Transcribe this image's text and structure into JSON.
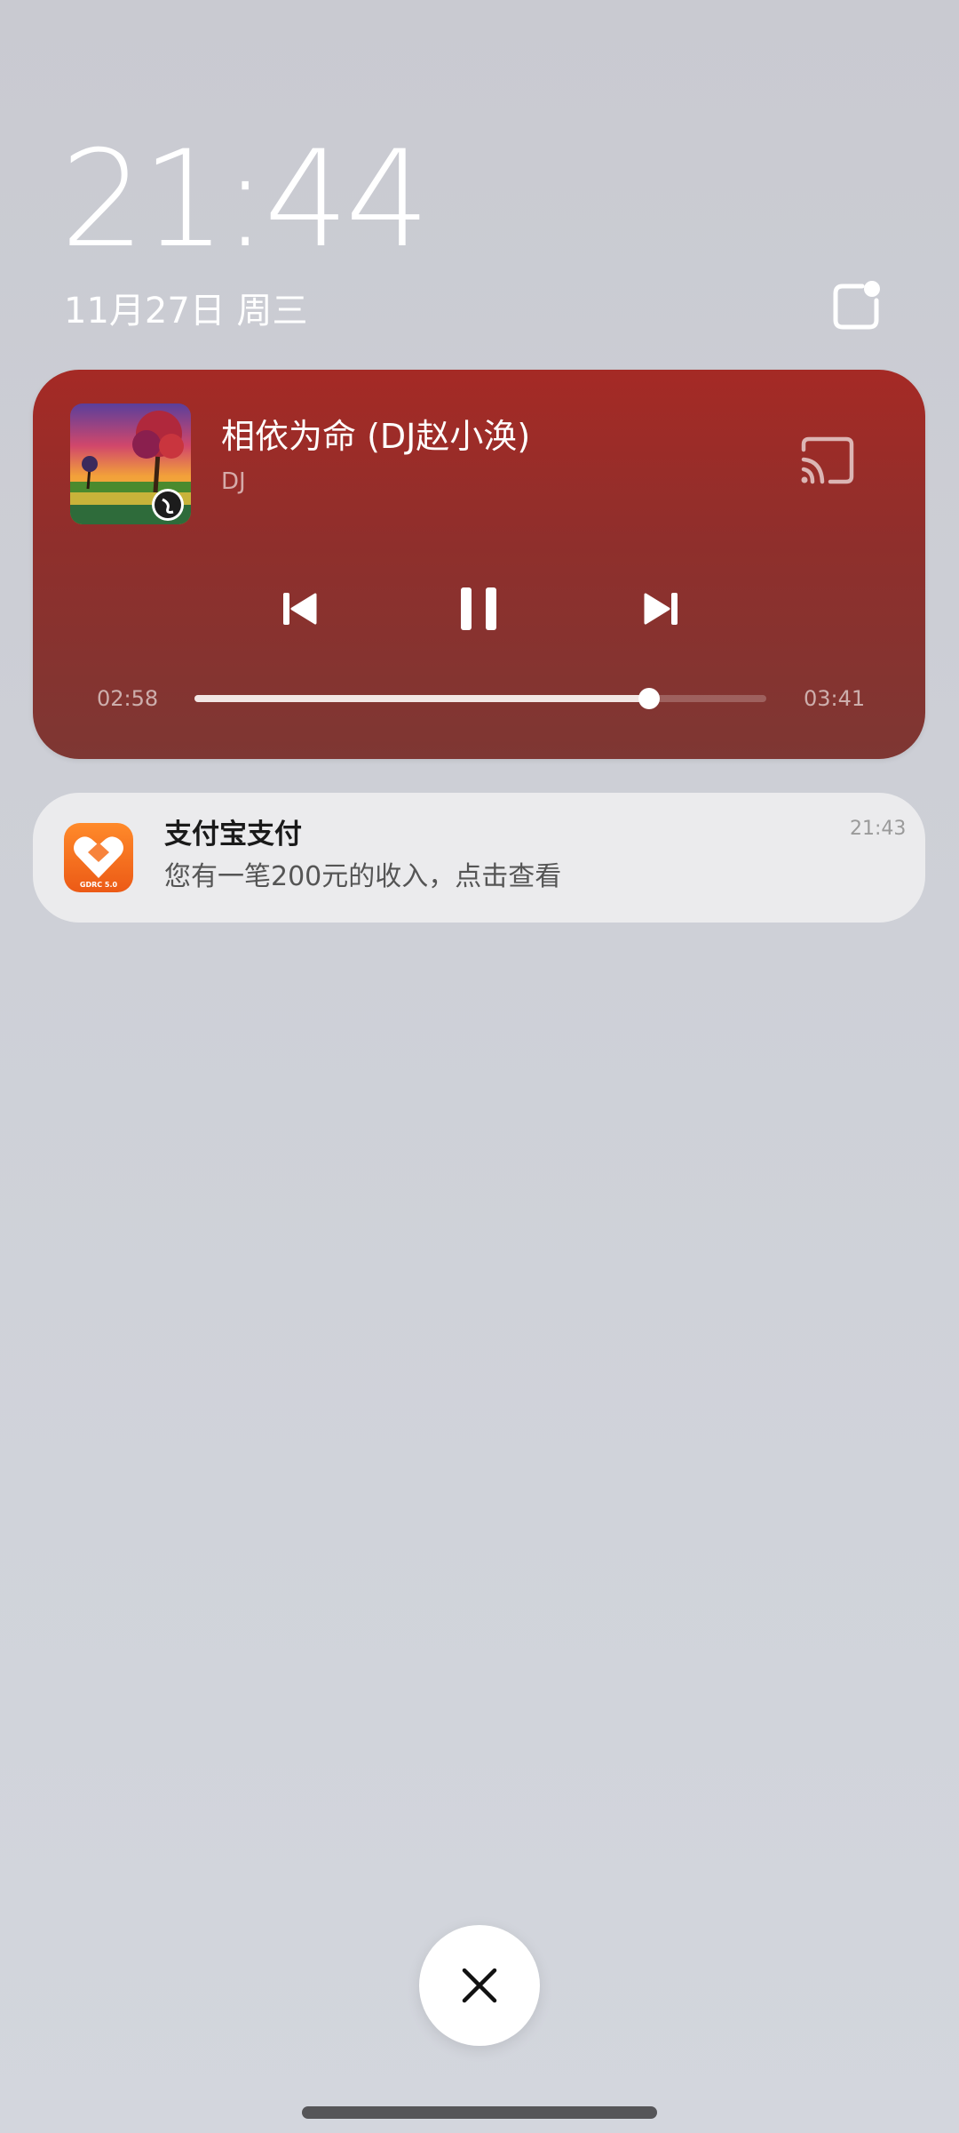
{
  "lockscreen": {
    "time": "21:44",
    "date": "11月27日 周三"
  },
  "media": {
    "title": "相依为命 (DJ赵小涣)",
    "artist": "DJ",
    "elapsed": "02:58",
    "duration": "03:41",
    "progress_fraction": 0.795,
    "card_color": "#9a2d29",
    "icons": {
      "cast": "cast-icon",
      "previous": "skip-previous-icon",
      "pause": "pause-icon",
      "next": "skip-next-icon"
    }
  },
  "notification": {
    "app_icon": "gdrc-heart-app-icon",
    "icon_label": "GDRC 5.0",
    "title": "支付宝支付",
    "body": "您有一笔200元的收入，点击查看",
    "time": "21:43",
    "icon_color": "#f06a1c"
  },
  "actions": {
    "close_icon": "close-icon"
  }
}
